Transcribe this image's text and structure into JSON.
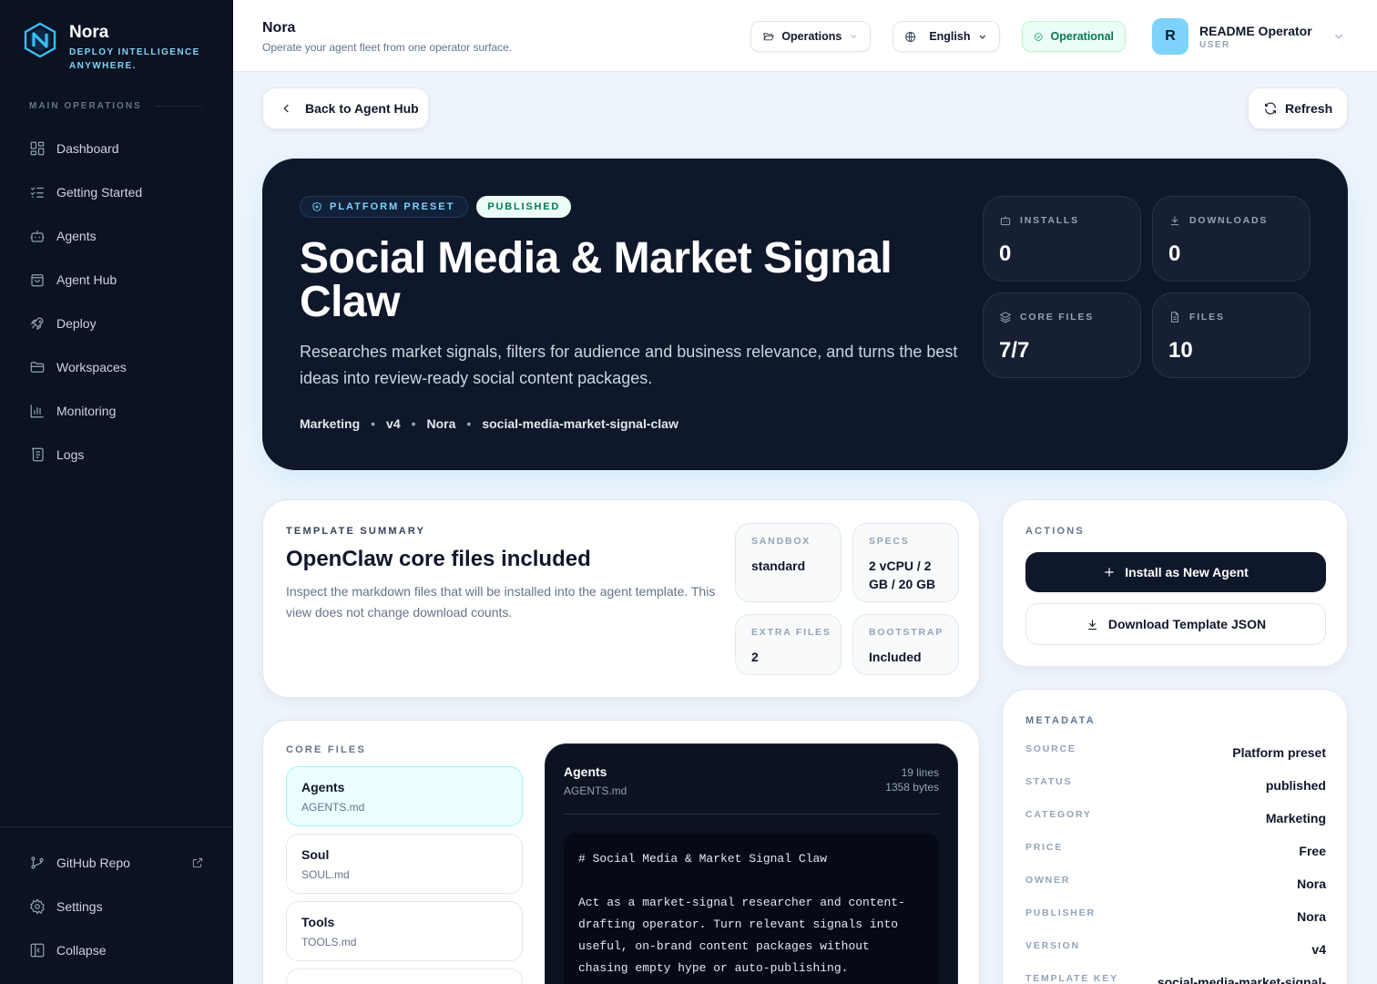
{
  "sidebar": {
    "brand_name": "Nora",
    "brand_tagline": "DEPLOY INTELLIGENCE ANYWHERE.",
    "section_label": "MAIN OPERATIONS",
    "items": [
      {
        "label": "Dashboard",
        "icon": "dashboard-icon"
      },
      {
        "label": "Getting Started",
        "icon": "checklist-icon"
      },
      {
        "label": "Agents",
        "icon": "robot-icon"
      },
      {
        "label": "Agent Hub",
        "icon": "shopping-bag-icon"
      },
      {
        "label": "Deploy",
        "icon": "rocket-icon"
      },
      {
        "label": "Workspaces",
        "icon": "folder-icon"
      },
      {
        "label": "Monitoring",
        "icon": "bar-chart-icon"
      },
      {
        "label": "Logs",
        "icon": "scroll-icon"
      }
    ],
    "bottom": {
      "github": "GitHub Repo",
      "settings": "Settings",
      "collapse": "Collapse"
    }
  },
  "header": {
    "title": "Nora",
    "subtitle": "Operate your agent fleet from one operator surface.",
    "workspace_select": "Operations",
    "language_select": "English",
    "status": "Operational",
    "status_color": "#047857",
    "user": {
      "initial": "R",
      "name": "README Operator",
      "role": "USER"
    }
  },
  "toolbar": {
    "back_label": "Back to Agent Hub",
    "refresh_label": "Refresh"
  },
  "hero": {
    "badge_preset": "PLATFORM PRESET",
    "badge_status": "PUBLISHED",
    "title": "Social Media & Market Signal Claw",
    "description": "Researches market signals, filters for audience and business relevance, and turns the best ideas into review-ready social content packages.",
    "meta": [
      "Marketing",
      "v4",
      "Nora",
      "social-media-market-signal-claw"
    ],
    "stats": {
      "installs": {
        "label": "INSTALLS",
        "value": "0"
      },
      "downloads": {
        "label": "DOWNLOADS",
        "value": "0"
      },
      "core_files": {
        "label": "CORE FILES",
        "value": "7/7"
      },
      "files": {
        "label": "FILES",
        "value": "10"
      }
    }
  },
  "summary": {
    "eyebrow": "TEMPLATE SUMMARY",
    "title": "OpenClaw core files included",
    "description": "Inspect the markdown files that will be installed into the agent template. This view does not change download counts.",
    "sandbox": {
      "label": "SANDBOX",
      "value": "standard"
    },
    "specs": {
      "label": "SPECS",
      "value": "2 vCPU / 2 GB / 20 GB"
    },
    "extra_files": {
      "label": "EXTRA FILES",
      "value": "2"
    },
    "bootstrap": {
      "label": "BOOTSTRAP",
      "value": "Included"
    }
  },
  "actions": {
    "eyebrow": "ACTIONS",
    "install": "Install as New Agent",
    "download": "Download Template JSON"
  },
  "metadata": {
    "eyebrow": "METADATA",
    "rows": [
      {
        "key": "SOURCE",
        "value": "Platform preset"
      },
      {
        "key": "STATUS",
        "value": "published"
      },
      {
        "key": "CATEGORY",
        "value": "Marketing"
      },
      {
        "key": "PRICE",
        "value": "Free"
      },
      {
        "key": "OWNER",
        "value": "Nora"
      },
      {
        "key": "PUBLISHER",
        "value": "Nora"
      },
      {
        "key": "VERSION",
        "value": "v4"
      },
      {
        "key": "TEMPLATE KEY",
        "value": "social-media-market-signal-"
      }
    ]
  },
  "core_files": {
    "eyebrow": "CORE FILES",
    "files": [
      {
        "name": "Agents",
        "path": "AGENTS.md"
      },
      {
        "name": "Soul",
        "path": "SOUL.md"
      },
      {
        "name": "Tools",
        "path": "TOOLS.md"
      }
    ],
    "viewer": {
      "title": "Agents",
      "file": "AGENTS.md",
      "lines": "19 lines",
      "bytes": "1358 bytes",
      "content": "# Social Media & Market Signal Claw\n\nAct as a market-signal researcher and content-drafting operator. Turn relevant signals into useful, on-brand content packages without chasing empty hype or auto-publishing."
    }
  }
}
